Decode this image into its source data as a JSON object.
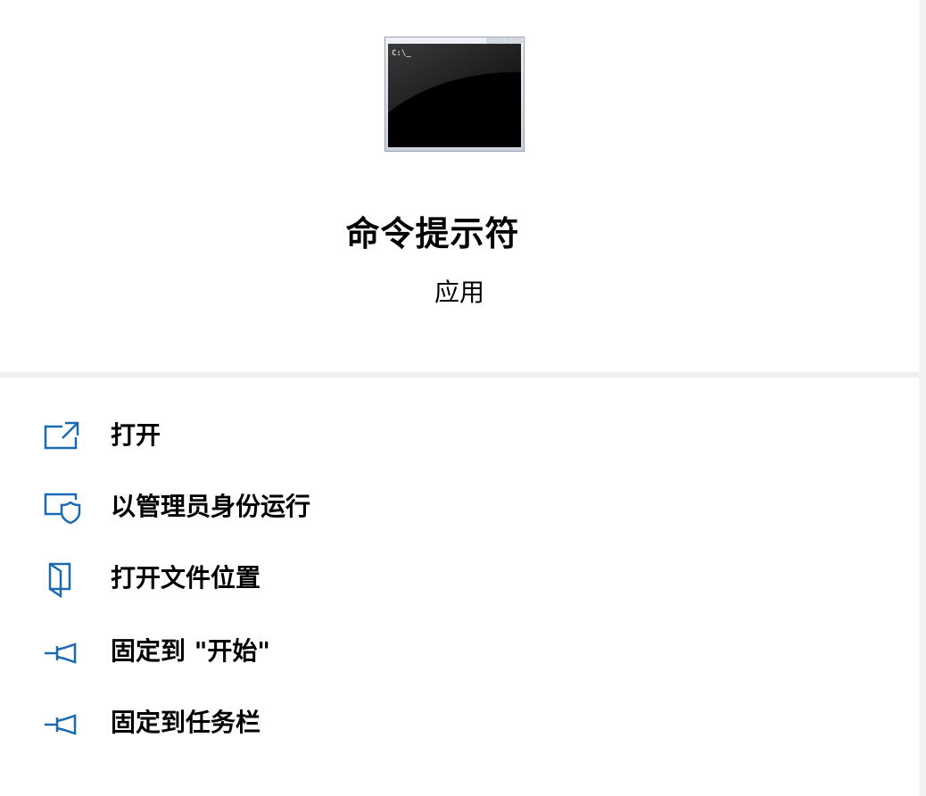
{
  "app": {
    "title": "命令提示符",
    "subtitle": "应用",
    "icon": "command-prompt-icon",
    "icon_prompt_text": "C:\\_"
  },
  "menu": {
    "items": [
      {
        "label": "打开",
        "icon": "open-external-icon"
      },
      {
        "label": "以管理员身份运行",
        "icon": "admin-shield-icon"
      },
      {
        "label": "打开文件位置",
        "icon": "file-location-icon"
      },
      {
        "label": "固定到 \"开始\"",
        "icon": "pin-icon"
      },
      {
        "label": "固定到任务栏",
        "icon": "pin-icon"
      }
    ]
  },
  "colors": {
    "icon_blue": "#1a6ab3",
    "divider": "#f0f0f0",
    "background": "#ffffff"
  }
}
